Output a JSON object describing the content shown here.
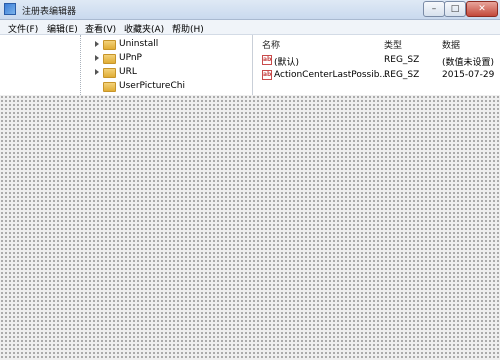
{
  "window": {
    "title": "注册表编辑器",
    "minimize_glyph": "–",
    "maximize_glyph": "□",
    "close_glyph": "✕"
  },
  "menu": [
    "文件(F)",
    "编辑(E)",
    "查看(V)",
    "收藏夹(A)",
    "帮助(H)"
  ],
  "tree": {
    "items": [
      "Uninstall",
      "UPnP",
      "URL",
      "UserPictureChi"
    ]
  },
  "list": {
    "columns": [
      "名称",
      "类型",
      "数据"
    ],
    "rows": [
      {
        "icon": "string-value-icon",
        "name": "(默认)",
        "type": "REG_SZ",
        "data": "(数值未设置)"
      },
      {
        "icon": "string-value-icon",
        "name": "ActionCenterLastPossib...",
        "type": "REG_SZ",
        "data": "2015-07-29"
      }
    ]
  }
}
